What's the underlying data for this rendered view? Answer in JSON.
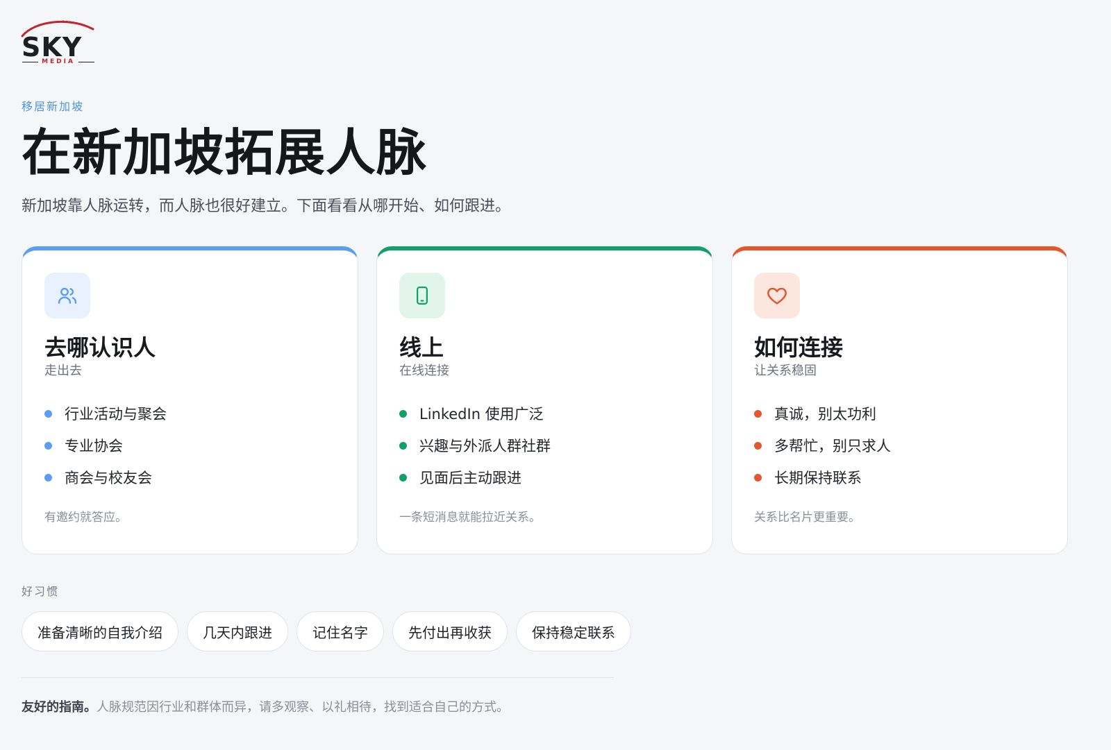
{
  "brand": {
    "name": "SKY",
    "sub": "MEDIA",
    "accent": "#c0262d"
  },
  "header": {
    "eyebrow": "移居新加坡",
    "title": "在新加坡拓展人脉",
    "subtitle": "新加坡靠人脉运转，而人脉也很好建立。下面看看从哪开始、如何跟进。"
  },
  "cards": [
    {
      "icon": "people-icon",
      "color": "#5b9ef0",
      "title": "去哪认识人",
      "sub": "走出去",
      "items": [
        "行业活动与聚会",
        "专业协会",
        "商会与校友会"
      ],
      "note": "有邀约就答应。"
    },
    {
      "icon": "phone-icon",
      "color": "#12a06a",
      "title": "线上",
      "sub": "在线连接",
      "items": [
        "LinkedIn 使用广泛",
        "兴趣与外派人群社群",
        "见面后主动跟进"
      ],
      "note": "一条短消息就能拉近关系。"
    },
    {
      "icon": "heart-icon",
      "color": "#e4572e",
      "title": "如何连接",
      "sub": "让关系稳固",
      "items": [
        "真诚，别太功利",
        "多帮忙，别只求人",
        "长期保持联系"
      ],
      "note": "关系比名片更重要。"
    }
  ],
  "habits": {
    "label": "好习惯",
    "chips": [
      "准备清晰的自我介绍",
      "几天内跟进",
      "记住名字",
      "先付出再收获",
      "保持稳定联系"
    ]
  },
  "footer": {
    "strong": "友好的指南。",
    "text": "人脉规范因行业和群体而异，请多观察、以礼相待，找到适合自己的方式。"
  }
}
